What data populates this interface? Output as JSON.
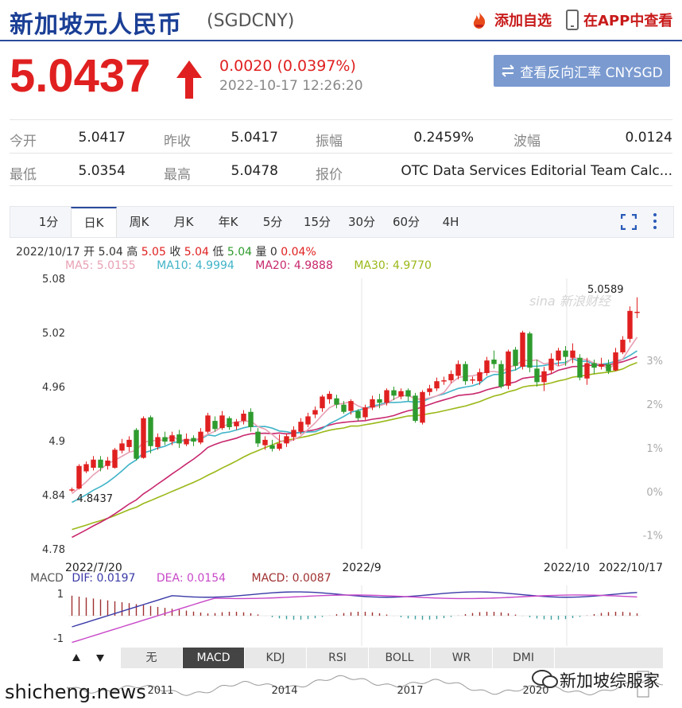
{
  "header": {
    "title": "新加坡元人民币",
    "code": "(SGDCNY)",
    "add_fav": "添加自选",
    "open_app": "在APP中查看"
  },
  "quote": {
    "price": "5.0437",
    "change": "0.0020 (0.0397%)",
    "time": "2022-10-17 12:26:20",
    "reverse_btn": "查看反向汇率 CNYSGD"
  },
  "stats": [
    [
      {
        "label": "今开",
        "value": "5.0417"
      },
      {
        "label": "昨收",
        "value": "5.0417"
      },
      {
        "label": "振幅",
        "value": "0.2459%"
      },
      {
        "label": "波幅",
        "value": "0.0124"
      }
    ],
    [
      {
        "label": "最低",
        "value": "5.0354"
      },
      {
        "label": "最高",
        "value": "5.0478"
      },
      {
        "label": "报价",
        "value": "OTC Data Services Editorial Team Calc..."
      }
    ]
  ],
  "tabs": [
    "1分",
    "日K",
    "周K",
    "月K",
    "年K",
    "5分",
    "15分",
    "30分",
    "60分",
    "4H"
  ],
  "active_tab": "日K",
  "info": {
    "date": "2022/10/17",
    "open_l": "开",
    "open": "5.04",
    "high_l": "高",
    "high": "5.05",
    "close_l": "收",
    "close": "5.04",
    "low_l": "低",
    "low": "5.04",
    "vol_l": "量",
    "vol": "0",
    "pct": "0.04%"
  },
  "ma": {
    "ma5": "MA5: 5.0155",
    "ma10": "MA10: 4.9994",
    "ma20": "MA20: 4.9888",
    "ma30": "MA30: 4.9770"
  },
  "macd_info": {
    "label": "MACD",
    "dif": "DIF: 0.0197",
    "dea": "DEA: 0.0154",
    "macd": "MACD: 0.0087"
  },
  "bottom_tabs": [
    "无",
    "MACD",
    "KDJ",
    "RSI",
    "BOLL",
    "WR",
    "DMI"
  ],
  "active_bottom": "MACD",
  "timeline_years": [
    "2011",
    "2014",
    "2017",
    "2020"
  ],
  "watermarks": {
    "site": "shicheng.news",
    "account": "新加坡综服家",
    "chart": "sina 新浪财经"
  },
  "colors": {
    "up": "#e02020",
    "down": "#2e9b2e",
    "ma5": "#e8a0b4",
    "ma10": "#40b4c8",
    "ma20": "#c8286e",
    "ma30": "#9ab818",
    "dif": "#3a3aa8",
    "dea": "#c848c8"
  },
  "chart_data": {
    "type": "candlestick",
    "y_left_ticks": [
      "5.08",
      "5.02",
      "4.96",
      "4.9",
      "4.84",
      "4.78"
    ],
    "y_right_ticks": [
      "3%",
      "2%",
      "1%",
      "0%",
      "-1%"
    ],
    "x_labels": [
      "2022/7/20",
      "2022/9",
      "2022/10",
      "2022/10/17"
    ],
    "ylim": [
      4.78,
      5.08
    ],
    "annotations": {
      "max": "5.0589",
      "min": "4.8437"
    },
    "candles": [
      [
        4.845,
        4.846,
        4.843,
        4.848
      ],
      [
        4.847,
        4.872,
        4.846,
        4.874
      ],
      [
        4.866,
        4.874,
        4.864,
        4.877
      ],
      [
        4.87,
        4.879,
        4.867,
        4.883
      ],
      [
        4.879,
        4.87,
        4.866,
        4.883
      ],
      [
        4.872,
        4.878,
        4.868,
        4.882
      ],
      [
        4.87,
        4.89,
        4.869,
        4.892
      ],
      [
        4.889,
        4.897,
        4.886,
        4.902
      ],
      [
        4.893,
        4.901,
        4.888,
        4.905
      ],
      [
        4.912,
        4.88,
        4.878,
        4.914
      ],
      [
        4.881,
        4.925,
        4.88,
        4.927
      ],
      [
        4.926,
        4.894,
        4.886,
        4.928
      ],
      [
        4.893,
        4.904,
        4.89,
        4.908
      ],
      [
        4.904,
        4.899,
        4.895,
        4.91
      ],
      [
        4.899,
        4.906,
        4.895,
        4.91
      ],
      [
        4.907,
        4.897,
        4.892,
        4.912
      ],
      [
        4.896,
        4.902,
        4.894,
        4.908
      ],
      [
        4.903,
        4.899,
        4.894,
        4.906
      ],
      [
        4.898,
        4.91,
        4.896,
        4.914
      ],
      [
        4.91,
        4.928,
        4.908,
        4.931
      ],
      [
        4.922,
        4.913,
        4.91,
        4.927
      ],
      [
        4.914,
        4.928,
        4.912,
        4.933
      ],
      [
        4.925,
        4.915,
        4.912,
        4.927
      ],
      [
        4.916,
        4.921,
        4.912,
        4.924
      ],
      [
        4.922,
        4.93,
        4.918,
        4.934
      ],
      [
        4.932,
        4.915,
        4.91,
        4.936
      ],
      [
        4.91,
        4.897,
        4.893,
        4.914
      ],
      [
        4.895,
        4.901,
        4.89,
        4.905
      ],
      [
        4.895,
        4.891,
        4.888,
        4.901
      ],
      [
        4.891,
        4.897,
        4.889,
        4.907
      ],
      [
        4.897,
        4.905,
        4.893,
        4.908
      ],
      [
        4.904,
        4.912,
        4.9,
        4.916
      ],
      [
        4.91,
        4.921,
        4.907,
        4.925
      ],
      [
        4.918,
        4.927,
        4.915,
        4.931
      ],
      [
        4.929,
        4.934,
        4.925,
        4.938
      ],
      [
        4.936,
        4.949,
        4.932,
        4.951
      ],
      [
        4.946,
        4.952,
        4.941,
        4.955
      ],
      [
        4.947,
        4.94,
        4.936,
        4.951
      ],
      [
        4.94,
        4.932,
        4.93,
        4.944
      ],
      [
        4.933,
        4.944,
        4.929,
        4.946
      ],
      [
        4.933,
        4.925,
        4.922,
        4.935
      ],
      [
        4.926,
        4.937,
        4.923,
        4.94
      ],
      [
        4.937,
        4.946,
        4.934,
        4.95
      ],
      [
        4.946,
        4.942,
        4.936,
        4.952
      ],
      [
        4.942,
        4.956,
        4.939,
        4.958
      ],
      [
        4.956,
        4.95,
        4.945,
        4.96
      ],
      [
        4.949,
        4.955,
        4.946,
        4.958
      ],
      [
        4.956,
        4.949,
        4.944,
        4.958
      ],
      [
        4.95,
        4.922,
        4.92,
        4.953
      ],
      [
        4.92,
        4.954,
        4.918,
        4.956
      ],
      [
        4.954,
        4.958,
        4.95,
        4.962
      ],
      [
        4.958,
        4.966,
        4.955,
        4.97
      ],
      [
        4.966,
        4.967,
        4.962,
        4.971
      ],
      [
        4.967,
        4.974,
        4.964,
        4.978
      ],
      [
        4.972,
        4.985,
        4.968,
        4.989
      ],
      [
        4.985,
        4.966,
        4.962,
        4.988
      ],
      [
        4.967,
        4.968,
        4.963,
        4.971
      ],
      [
        4.966,
        4.976,
        4.962,
        4.98
      ],
      [
        4.975,
        4.989,
        4.972,
        4.993
      ],
      [
        4.99,
        4.985,
        4.98,
        5.0
      ],
      [
        4.985,
        4.96,
        4.958,
        4.989
      ],
      [
        4.961,
        4.999,
        4.957,
        5.001
      ],
      [
        5.001,
        4.983,
        4.978,
        5.004
      ],
      [
        4.982,
        5.02,
        4.979,
        5.022
      ],
      [
        5.019,
        4.981,
        4.976,
        5.021
      ],
      [
        4.98,
        4.965,
        4.96,
        4.99
      ],
      [
        4.965,
        4.977,
        4.955,
        4.982
      ],
      [
        4.978,
        4.991,
        4.974,
        4.997
      ],
      [
        4.989,
        5.0,
        4.983,
        5.003
      ],
      [
        5.0,
        4.993,
        4.983,
        5.005
      ],
      [
        4.992,
        5.0,
        4.986,
        5.008
      ],
      [
        4.992,
        4.97,
        4.967,
        4.996
      ],
      [
        4.969,
        4.986,
        4.962,
        4.992
      ],
      [
        4.986,
        4.981,
        4.974,
        4.99
      ],
      [
        4.982,
        4.985,
        4.979,
        4.992
      ],
      [
        4.985,
        4.977,
        4.974,
        4.99
      ],
      [
        4.978,
        4.998,
        4.977,
        5.003
      ],
      [
        4.998,
        5.012,
        4.996,
        5.016
      ],
      [
        5.013,
        5.044,
        5.009,
        5.049
      ],
      [
        5.043,
        5.043,
        5.036,
        5.059
      ]
    ]
  }
}
